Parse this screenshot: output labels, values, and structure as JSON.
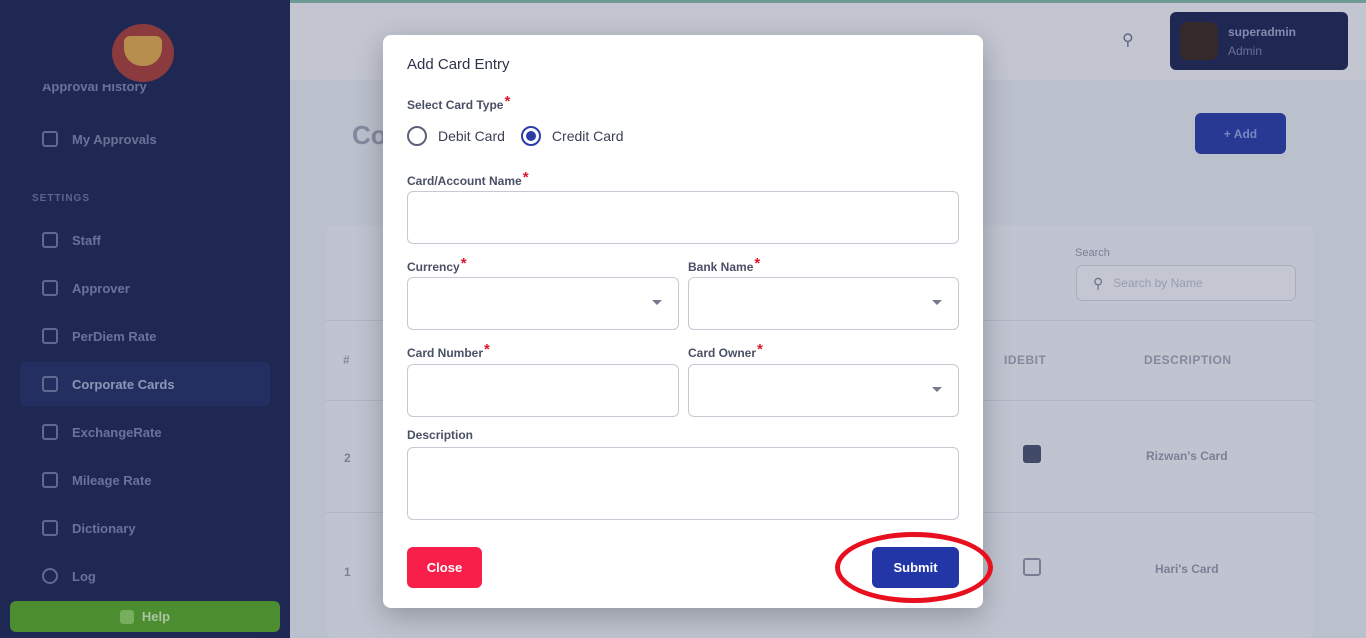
{
  "sidebar": {
    "partial_item": "Approval History",
    "items": [
      {
        "label": "My Approvals",
        "icon": "clipboard-icon"
      },
      {
        "label": "Staff",
        "icon": "users-icon"
      },
      {
        "label": "Approver",
        "icon": "user-check-icon"
      },
      {
        "label": "PerDiem Rate",
        "icon": "calculator-icon"
      },
      {
        "label": "Corporate Cards",
        "icon": "card-icon"
      },
      {
        "label": "ExchangeRate",
        "icon": "exchange-icon"
      },
      {
        "label": "Mileage Rate",
        "icon": "car-icon"
      },
      {
        "label": "Dictionary",
        "icon": "book-icon"
      },
      {
        "label": "Log",
        "icon": "clock-icon"
      }
    ],
    "settings_label": "SETTINGS",
    "help_label": "Help"
  },
  "topbar": {
    "user_name": "superadmin",
    "user_role": "Admin"
  },
  "page": {
    "title": "Co",
    "add_label": "+ Add",
    "search_label": "Search",
    "search_placeholder": "Search by Name",
    "columns": {
      "num": "#",
      "debit": "IDEBIT",
      "description": "DESCRIPTION"
    },
    "rows": [
      {
        "num": "2",
        "debit_checked": true,
        "description": "Rizwan's Card"
      },
      {
        "num": "1",
        "debit_checked": false,
        "description": "Hari's Card"
      }
    ]
  },
  "modal": {
    "title": "Add Card Entry",
    "card_type_label": "Select Card Type",
    "required_mark": "*",
    "card_types": [
      {
        "label": "Debit Card",
        "checked": false
      },
      {
        "label": "Credit Card",
        "checked": true
      }
    ],
    "account_name_label": "Card/Account Name",
    "currency_label": "Currency",
    "bank_label": "Bank Name",
    "card_number_label": "Card Number",
    "owner_label": "Card Owner",
    "description_label": "Description",
    "close_label": "Close",
    "submit_label": "Submit"
  },
  "colors": {
    "sidebar": "#1f2a5a",
    "primary": "#2236a8",
    "danger": "#f81f4a",
    "required": "#e0152b",
    "highlight": "#e8101e"
  }
}
